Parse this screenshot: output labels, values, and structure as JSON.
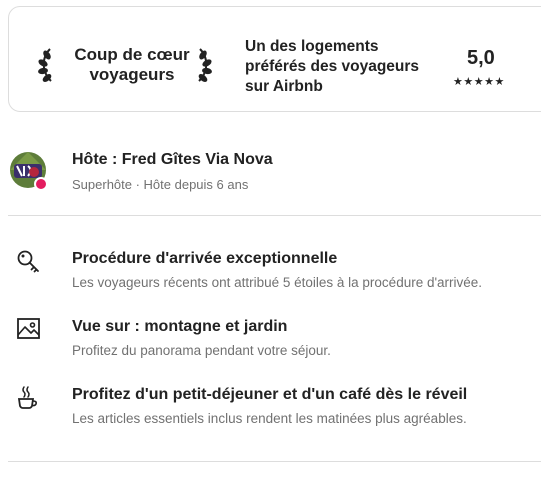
{
  "highlight": {
    "badge_title": "Coup de cœur voyageurs",
    "badge_description": "Un des logements préférés des voyageurs sur Airbnb",
    "rating": "5,0",
    "stars": "★★★★★"
  },
  "host": {
    "name": "Hôte : Fred Gîtes Via Nova",
    "subtitle": "Superhôte · Hôte depuis 6 ans",
    "avatar_icon": "host-avatar",
    "superhost_badge_color": "#e31c5f"
  },
  "features": [
    {
      "icon": "key-icon",
      "title": "Procédure d'arrivée exceptionnelle",
      "description": "Les voyageurs récents ont attribué 5 étoiles à la procédure d'arrivée."
    },
    {
      "icon": "picture-icon",
      "title": "Vue sur : montagne et jardin",
      "description": "Profitez du panorama pendant votre séjour."
    },
    {
      "icon": "coffee-icon",
      "title": "Profitez d'un petit-déjeuner et d'un café dès le réveil",
      "description": "Les articles essentiels inclus rendent les matinées plus agréables."
    }
  ]
}
